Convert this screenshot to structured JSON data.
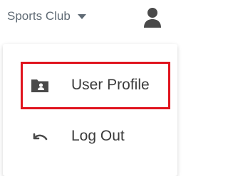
{
  "header": {
    "club_name": "Sports Club",
    "club_dropdown_icon": "caret-down-icon",
    "user_icon": "person-icon"
  },
  "menu": {
    "items": [
      {
        "label": "User Profile",
        "icon": "id-card-folder-icon",
        "highlighted": true
      },
      {
        "label": "Log Out",
        "icon": "undo-arrow-icon",
        "highlighted": false
      }
    ]
  },
  "colors": {
    "text_muted": "#5f6a74",
    "text_menu": "#3b3b3b",
    "icon": "#4a4a4a",
    "highlight_border": "#e0141e"
  }
}
